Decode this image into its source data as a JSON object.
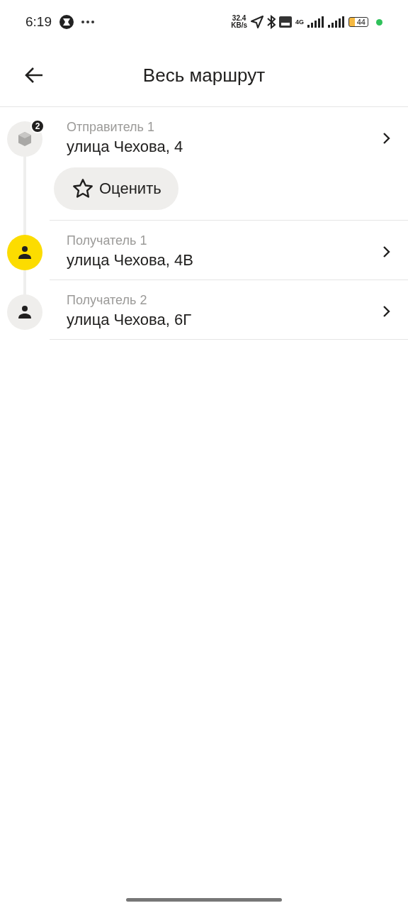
{
  "status_bar": {
    "time": "6:19",
    "speed_value": "32.4",
    "speed_unit": "KB/s",
    "network": "4G",
    "battery": "44"
  },
  "header": {
    "title": "Весь маршрут"
  },
  "stops": [
    {
      "kind": "sender",
      "label": "Отправитель 1",
      "address": "улица Чехова, 4",
      "badge": "2",
      "active": false,
      "action": "Оценить"
    },
    {
      "kind": "recipient",
      "label": "Получатель 1",
      "address": "улица Чехова, 4В",
      "active": true
    },
    {
      "kind": "recipient",
      "label": "Получатель 2",
      "address": "улица Чехова, 6Г",
      "active": false
    }
  ]
}
